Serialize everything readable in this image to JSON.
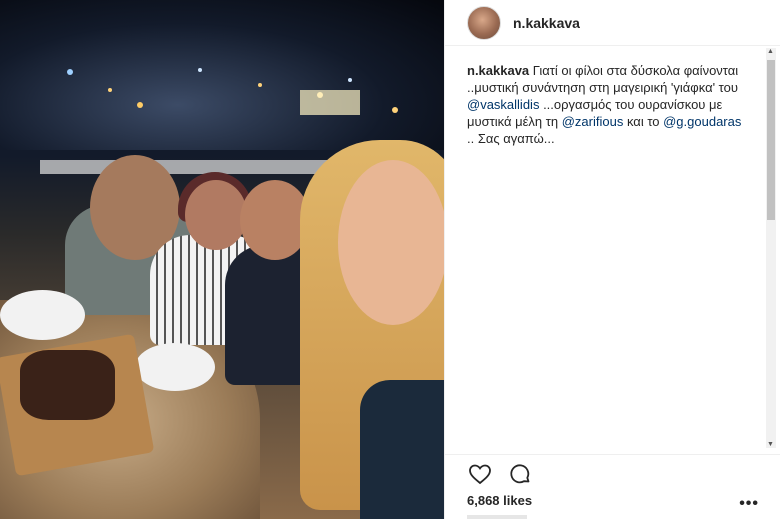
{
  "post": {
    "username": "n.kakkava",
    "caption_user": "n.kakkava",
    "caption_parts": [
      {
        "type": "text",
        "value": " Γιατί οι φίλοι στα δύσκολα φαίνονται ..μυστική συνάντηση στη μαγειρική 'γιάφκα' του "
      },
      {
        "type": "mention",
        "value": "@vaskallidis"
      },
      {
        "type": "text",
        "value": " ...οργασμός του ουρανίσκου με μυστικά μέλη τη "
      },
      {
        "type": "mention",
        "value": "@zarifious"
      },
      {
        "type": "text",
        "value": " και το "
      },
      {
        "type": "mention",
        "value": "@g.goudaras"
      },
      {
        "type": "text",
        "value": " .. Σας αγαπώ..."
      }
    ],
    "likes": "6,868 likes",
    "more_label": "•••",
    "photo_alt": "Selfie of four friends at a dinner table on a rooftop terrace at night"
  },
  "icons": {
    "like": "heart-icon",
    "comment": "comment-icon"
  },
  "colors": {
    "mention": "#003569",
    "text": "#262626",
    "border": "#efefef"
  }
}
